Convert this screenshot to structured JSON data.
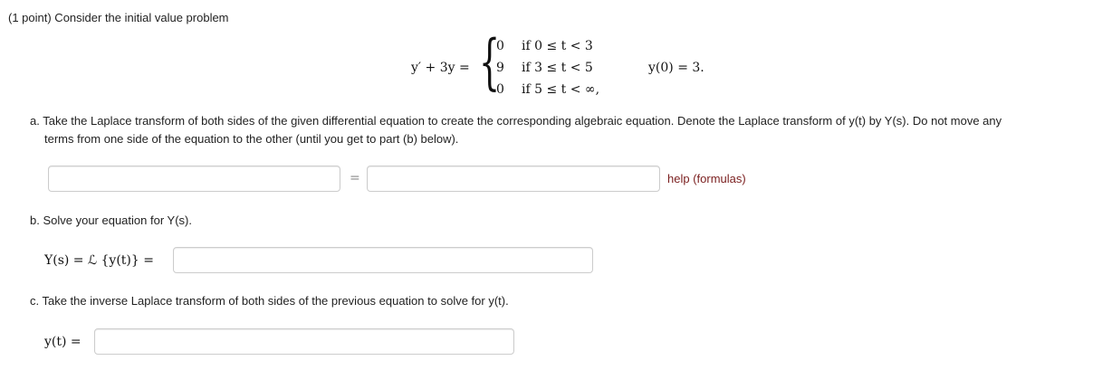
{
  "problem": {
    "header": "(1 point) Consider the initial value problem",
    "lhs": "y′ + 3y =",
    "cases": [
      {
        "value": "0",
        "condition": "if 0 ≤ t < 3"
      },
      {
        "value": "9",
        "condition": "if 3 ≤ t < 5"
      },
      {
        "value": "0",
        "condition": "if 5 ≤ t < ∞,"
      }
    ],
    "initial_condition": "y(0) = 3."
  },
  "part_a": {
    "text_line1": "a. Take the Laplace transform of both sides of the given differential equation to create the corresponding algebraic equation. Denote the Laplace transform of y(t) by Y(s). Do not move any",
    "text_line2": "terms from one side of the equation to the other (until you get to part (b) below).",
    "left_value": "",
    "equals": "=",
    "right_value": "",
    "help_link": "help (formulas)"
  },
  "part_b": {
    "text": "b. Solve your equation for Y(s).",
    "label": "Y(s) = ℒ {y(t)} =",
    "value": ""
  },
  "part_c": {
    "text": "c. Take the inverse Laplace transform of both sides of the previous equation to solve for y(t).",
    "label": "y(t) =",
    "value": ""
  }
}
